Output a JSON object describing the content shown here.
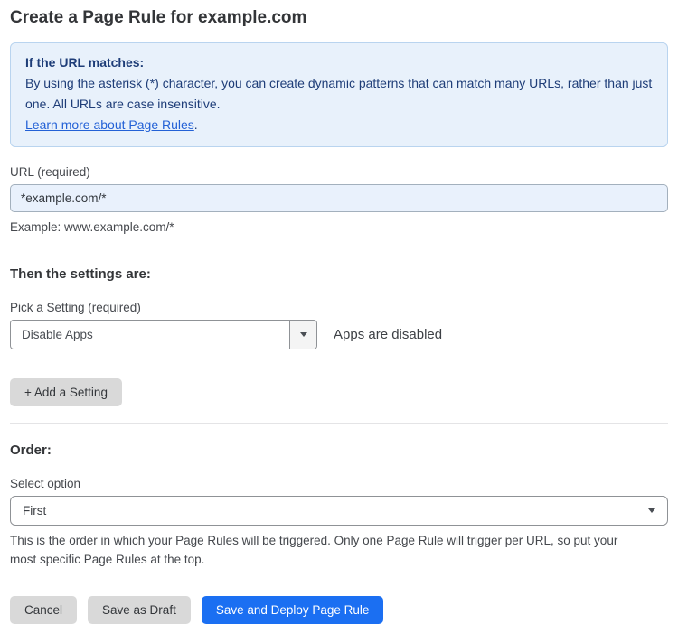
{
  "page": {
    "title": "Create a Page Rule for example.com"
  },
  "info_box": {
    "heading": "If the URL matches:",
    "body": "By using the asterisk (*) character, you can create dynamic patterns that can match many URLs, rather than just one. All URLs are case insensitive.",
    "link_label": "Learn more about Page Rules",
    "link_suffix": "."
  },
  "url_field": {
    "label": "URL (required)",
    "value": "*example.com/*",
    "example": "Example: www.example.com/*"
  },
  "settings": {
    "heading": "Then the settings are:",
    "picker_label": "Pick a Setting (required)",
    "selected_setting": "Disable Apps",
    "status_text": "Apps are disabled",
    "add_setting_label": "+ Add a Setting"
  },
  "order": {
    "heading": "Order:",
    "select_label": "Select option",
    "selected_option": "First",
    "help_text": "This is the order in which your Page Rules will be triggered. Only one Page Rule will trigger per URL, so put your most specific Page Rules at the top."
  },
  "footer": {
    "cancel_label": "Cancel",
    "save_draft_label": "Save as Draft",
    "save_deploy_label": "Save and Deploy Page Rule"
  },
  "colors": {
    "info_box_background": "#e8f1fb",
    "info_box_border": "#b9d4ef",
    "info_box_text": "#1e3d78",
    "link_blue": "#2361d6",
    "url_input_background": "#e9f1fc",
    "primary_button_blue": "#1b6ff2",
    "secondary_button_gray": "#d9d9d9"
  }
}
